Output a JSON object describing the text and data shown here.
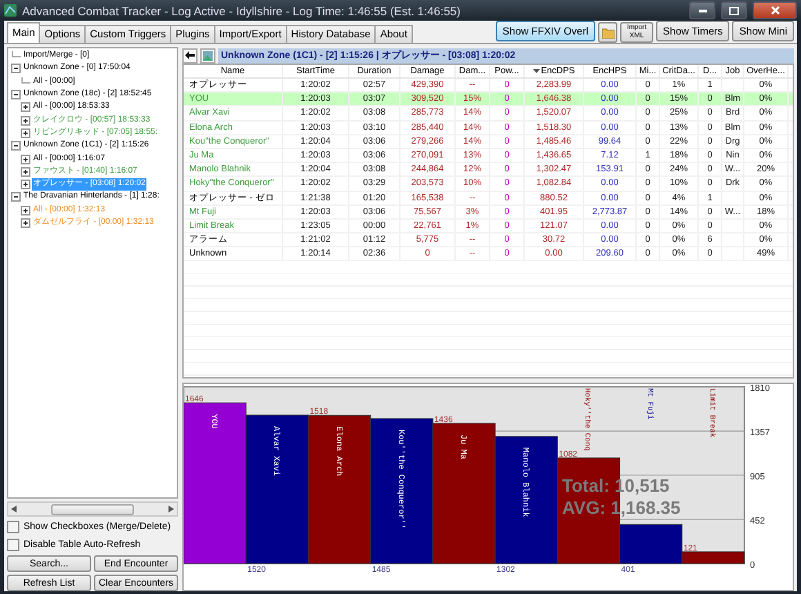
{
  "window": {
    "title": "Advanced Combat Tracker - Log Active - Idyllshire - Log Time: 1:46:55 (Est. 1:46:55)"
  },
  "tabs": [
    {
      "label": "Main",
      "selected": true
    },
    {
      "label": "Options",
      "selected": false
    },
    {
      "label": "Custom Triggers",
      "selected": false
    },
    {
      "label": "Plugins",
      "selected": false
    },
    {
      "label": "Import/Export",
      "selected": false
    },
    {
      "label": "History Database",
      "selected": false
    },
    {
      "label": "About",
      "selected": false
    }
  ],
  "toolbar": {
    "overlay_button": {
      "label": "Show FFXIV Overl",
      "highlighted": true
    },
    "import_xml": [
      "Import",
      "XML"
    ],
    "timers_button": "Show Timers",
    "mini_button": "Show Mini"
  },
  "tree": [
    {
      "label": "Import/Merge - [0]",
      "kind": "entry",
      "selected": false
    },
    {
      "label": "Unknown Zone - [0] 17:50:04",
      "kind": "node",
      "expanded": true,
      "selected": false,
      "children": [
        {
          "label": "All - [00:00]",
          "kind": "entry",
          "selected": false
        }
      ]
    },
    {
      "label": "Unknown Zone (18c) - [2] 18:52:45",
      "kind": "node",
      "expanded": true,
      "selected": false,
      "children": [
        {
          "label": "All - [00:00] 18:53:33",
          "kind": "node",
          "expanded": false,
          "selected": false
        },
        {
          "label": "クレイクロウ - [00:57] 18:53:33",
          "kind": "node",
          "expanded": false,
          "selected": false,
          "color": "#3c9c3c"
        },
        {
          "label": "リビングリキッド - [07:05] 18:55:",
          "kind": "node",
          "expanded": false,
          "selected": false,
          "color": "#3c9c3c"
        }
      ]
    },
    {
      "label": "Unknown Zone (1C1) - [2] 1:15:26",
      "kind": "node",
      "expanded": true,
      "selected": false,
      "children": [
        {
          "label": "All - [00:00] 1:16:07",
          "kind": "node",
          "expanded": false,
          "selected": false
        },
        {
          "label": "ファウスト - [01:40] 1:16:07",
          "kind": "node",
          "expanded": false,
          "selected": false,
          "color": "#3c9c3c"
        },
        {
          "label": "オプレッサー - [03:08] 1:20:02",
          "kind": "node",
          "expanded": false,
          "selected": true
        }
      ]
    },
    {
      "label": "The Dravanian Hinterlands - [1] 1:28:",
      "kind": "node",
      "expanded": true,
      "selected": false,
      "children": [
        {
          "label": "All - [00:00] 1:32:13",
          "kind": "node",
          "expanded": false,
          "selected": false,
          "color": "#f08c1e"
        },
        {
          "label": "ダムゼルフライ - [00:00] 1:32:13",
          "kind": "node",
          "expanded": false,
          "selected": false,
          "color": "#f08c1e"
        }
      ]
    }
  ],
  "options": [
    {
      "label": "Show Checkboxes (Merge/Delete)",
      "checked": false
    },
    {
      "label": "Disable Table Auto-Refresh",
      "checked": false
    }
  ],
  "buttons": [
    "Search...",
    "End Encounter",
    "Refresh List",
    "Clear Encounters"
  ],
  "encounter_title": "Unknown Zone (1C1) - [2] 1:15:26 | オプレッサー - [03:08] 1:20:02",
  "table": {
    "columns": [
      {
        "label": "Name",
        "sorted": false
      },
      {
        "label": "StartTime",
        "sorted": false
      },
      {
        "label": "Duration",
        "sorted": false
      },
      {
        "label": "Damage",
        "sorted": false
      },
      {
        "label": "Dam...",
        "sorted": false
      },
      {
        "label": "Pow...",
        "sorted": false
      },
      {
        "label": "EncDPS",
        "sorted": true
      },
      {
        "label": "EncHPS",
        "sorted": false
      },
      {
        "label": "Mi...",
        "sorted": false
      },
      {
        "label": "CritDa...",
        "sorted": false
      },
      {
        "label": "D...",
        "sorted": false
      },
      {
        "label": "Job",
        "sorted": false
      },
      {
        "label": "OverHe...",
        "sorted": false
      }
    ],
    "rows": [
      {
        "selected": false,
        "cells": [
          "オプレッサー",
          "1:20:02",
          "02:57",
          "429,390",
          "--",
          "0",
          "2,283.99",
          "0.00",
          "0",
          "1%",
          "1",
          null,
          "0%"
        ]
      },
      {
        "selected": true,
        "color": "#3c9c3c",
        "cells": [
          "YOU",
          "1:20:03",
          "03:07",
          "309,520",
          "15%",
          "0",
          "1,646.38",
          "0.00",
          "0",
          "15%",
          "0",
          "Blm",
          "0%"
        ]
      },
      {
        "selected": false,
        "color": "#3c9c3c",
        "cells": [
          "Alvar Xavi",
          "1:20:02",
          "03:08",
          "285,773",
          "14%",
          "0",
          "1,520.07",
          "0.00",
          "0",
          "25%",
          "0",
          "Brd",
          "0%"
        ]
      },
      {
        "selected": false,
        "color": "#3c9c3c",
        "cells": [
          "Elona Arch",
          "1:20:03",
          "03:10",
          "285,440",
          "14%",
          "0",
          "1,518.30",
          "0.00",
          "0",
          "13%",
          "0",
          "Blm",
          "0%"
        ]
      },
      {
        "selected": false,
        "color": "#3c9c3c",
        "cells": [
          "Kou''the Conqueror''",
          "1:20:04",
          "03:06",
          "279,266",
          "14%",
          "0",
          "1,485.46",
          "99.64",
          "0",
          "22%",
          "0",
          "Drg",
          "0%"
        ]
      },
      {
        "selected": false,
        "color": "#3c9c3c",
        "cells": [
          "Ju Ma",
          "1:20:03",
          "03:06",
          "270,091",
          "13%",
          "0",
          "1,436.65",
          "7.12",
          "1",
          "18%",
          "0",
          "Nin",
          "0%"
        ]
      },
      {
        "selected": false,
        "color": "#3c9c3c",
        "cells": [
          "Manolo Blahnik",
          "1:20:04",
          "03:08",
          "244,864",
          "12%",
          "0",
          "1,302.47",
          "153.91",
          "0",
          "24%",
          "0",
          "W...",
          "20%"
        ]
      },
      {
        "selected": false,
        "color": "#3c9c3c",
        "cells": [
          "Hoky''the Conqueror''",
          "1:20:02",
          "03:29",
          "203,573",
          "10%",
          "0",
          "1,082.84",
          "0.00",
          "0",
          "10%",
          "0",
          "Drk",
          "0%"
        ]
      },
      {
        "selected": false,
        "cells": [
          "オプレッサー - ゼロ",
          "1:21:38",
          "01:20",
          "165,538",
          "--",
          "0",
          "880.52",
          "0.00",
          "0",
          "4%",
          "1",
          null,
          "0%"
        ]
      },
      {
        "selected": false,
        "color": "#3c9c3c",
        "cells": [
          "Mt Fuji",
          "1:20:03",
          "03:06",
          "75,567",
          "3%",
          "0",
          "401.95",
          "2,773.87",
          "0",
          "14%",
          "0",
          "W...",
          "18%"
        ]
      },
      {
        "selected": false,
        "color": "#3c9c3c",
        "cells": [
          "Limit Break",
          "1:23:05",
          "00:00",
          "22,761",
          "1%",
          "0",
          "121.07",
          "0.00",
          "0",
          "0%",
          "0",
          null,
          "0%"
        ]
      },
      {
        "selected": false,
        "cells": [
          "アラーム",
          "1:21:02",
          "01:12",
          "5,775",
          "--",
          "0",
          "30.72",
          "0.00",
          "0",
          "0%",
          "6",
          null,
          "0%"
        ]
      },
      {
        "selected": false,
        "cells": [
          "Unknown",
          "1:20:14",
          "02:36",
          "0",
          "--",
          "0",
          "0.00",
          "209.60",
          "0",
          "0%",
          "0",
          null,
          "49%"
        ]
      }
    ]
  },
  "chart": {
    "total": "Total: 10,515",
    "average": "AVG: 1,168.35",
    "chart_data": {
      "type": "bar",
      "categories": [
        "YOU",
        "Alvar Xavi",
        "Elona Arch",
        "Kou''the Conqueror''",
        "Ju Ma",
        "Manolo Blahnik",
        "Hoky''the Conq",
        "Mt Fuji",
        "Limit Break"
      ],
      "series": [
        {
          "values": [
            1646,
            1520,
            1518,
            1485,
            1436,
            1302,
            1082,
            401,
            121
          ]
        }
      ],
      "grid": true,
      "colors": [
        "#9400d3",
        "#00008b",
        "#8b0000",
        "#00008b",
        "#8b0000",
        "#00008b",
        "#8b0000",
        "#00008b",
        "#8b0000"
      ],
      "value_labels": [
        "1646",
        "1520",
        "1518",
        "1485",
        "1436",
        "1302",
        "1082",
        "401",
        "121"
      ],
      "ylim": [
        0,
        1810
      ],
      "yticks": [
        0,
        452,
        905,
        1357,
        1810
      ]
    }
  }
}
